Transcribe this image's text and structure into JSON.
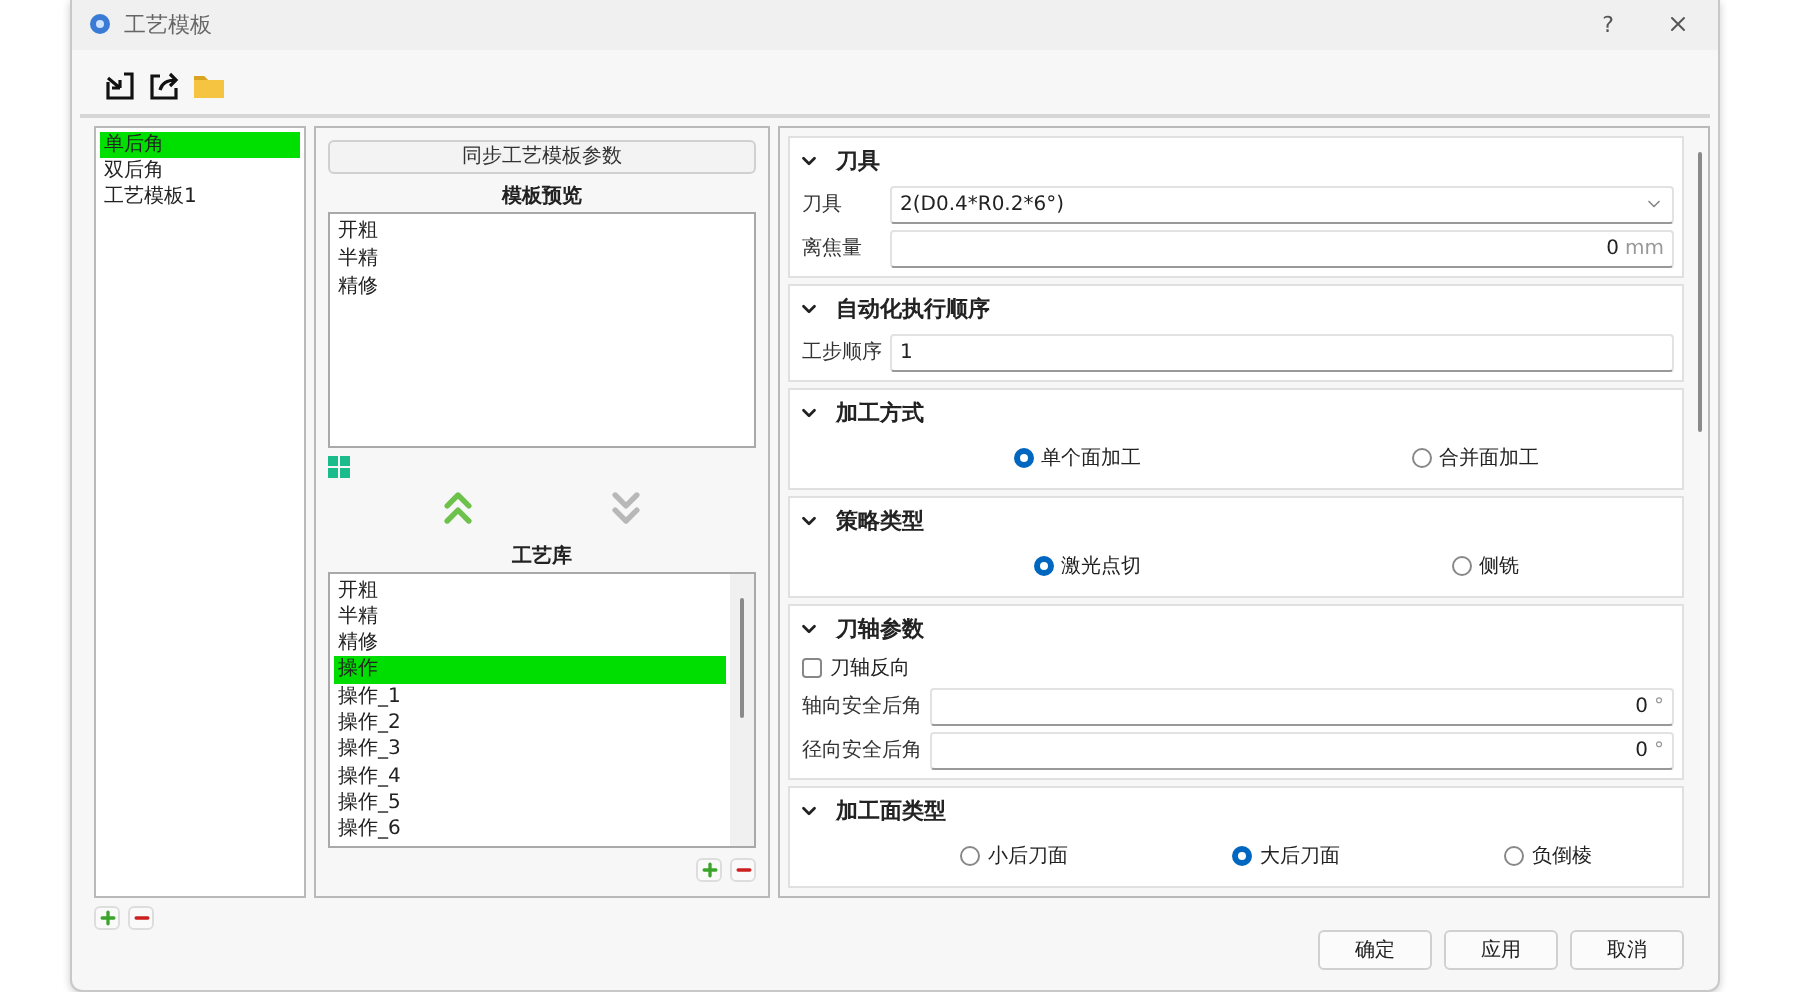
{
  "window": {
    "title": "工艺模板",
    "help": "?"
  },
  "templates": [
    {
      "label": "单后角",
      "selected": true
    },
    {
      "label": "双后角",
      "selected": false
    },
    {
      "label": "工艺模板1",
      "selected": false
    }
  ],
  "sync_button": "同步工艺模板参数",
  "preview": {
    "title": "模板预览",
    "items": [
      "开粗",
      "半精",
      "精修"
    ]
  },
  "library": {
    "title": "工艺库",
    "items": [
      {
        "label": "开粗",
        "selected": false
      },
      {
        "label": "半精",
        "selected": false
      },
      {
        "label": "精修",
        "selected": false
      },
      {
        "label": "操作",
        "selected": true
      },
      {
        "label": "操作_1",
        "selected": false
      },
      {
        "label": "操作_2",
        "selected": false
      },
      {
        "label": "操作_3",
        "selected": false
      },
      {
        "label": "操作_4",
        "selected": false
      },
      {
        "label": "操作_5",
        "selected": false
      },
      {
        "label": "操作_6",
        "selected": false
      }
    ]
  },
  "sections": [
    {
      "title": "刀具",
      "expanded": true,
      "rows": [
        {
          "kind": "select",
          "label": "刀具",
          "value": "2(D0.4*R0.2*6°)"
        },
        {
          "kind": "number",
          "label": "离焦量",
          "value": "0",
          "unit": "mm"
        }
      ]
    },
    {
      "title": "自动化执行顺序",
      "expanded": true,
      "rows": [
        {
          "kind": "text",
          "label": "工步顺序",
          "value": "1"
        }
      ]
    },
    {
      "title": "加工方式",
      "expanded": true,
      "rows": [
        {
          "kind": "radios",
          "options": [
            {
              "label": "单个面加工",
              "selected": true
            },
            {
              "label": "合并面加工",
              "selected": false
            }
          ]
        }
      ]
    },
    {
      "title": "策略类型",
      "expanded": true,
      "rows": [
        {
          "kind": "radios",
          "options": [
            {
              "label": "激光点切",
              "selected": true
            },
            {
              "label": "侧铣",
              "selected": false
            }
          ]
        }
      ]
    },
    {
      "title": "刀轴参数",
      "expanded": true,
      "rows": [
        {
          "kind": "checkbox",
          "label": "刀轴反向",
          "checked": false
        },
        {
          "kind": "number",
          "label": "轴向安全后角",
          "value": "0",
          "unit": "°"
        },
        {
          "kind": "number",
          "label": "径向安全后角",
          "value": "0",
          "unit": "°"
        }
      ]
    },
    {
      "title": "加工面类型",
      "expanded": true,
      "rows": [
        {
          "kind": "radios",
          "options": [
            {
              "label": "小后刀面",
              "selected": false
            },
            {
              "label": "大后刀面",
              "selected": true
            },
            {
              "label": "负倒棱",
              "selected": false
            }
          ]
        }
      ]
    }
  ],
  "buttons": [
    "确定",
    "应用",
    "取消"
  ]
}
